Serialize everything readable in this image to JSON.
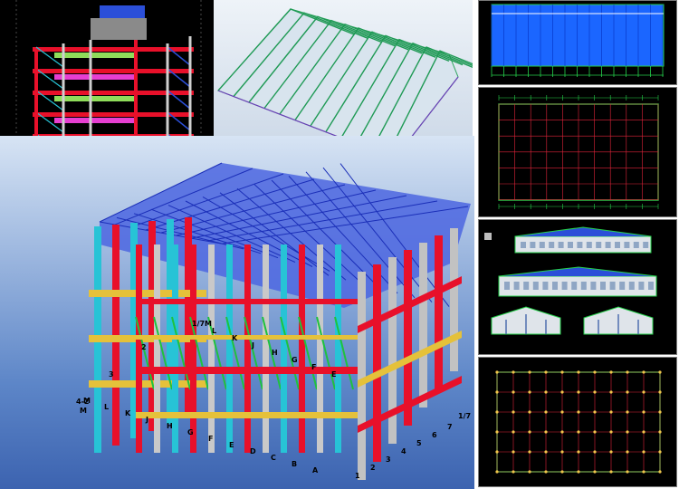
{
  "main_labels": {
    "top_right_axis": "1/7",
    "front_axis_letters": [
      "M",
      "L",
      "K",
      "J",
      "H",
      "G",
      "F",
      "E",
      "D",
      "C",
      "B",
      "A"
    ],
    "right_axis_numbers": [
      "1",
      "2",
      "3",
      "4",
      "5",
      "6",
      "7"
    ],
    "upper_axis_letters": [
      "1/7M",
      "L",
      "K",
      "J",
      "H",
      "G",
      "F",
      "E"
    ],
    "left_level_numbers": [
      "4-2",
      "3",
      "2"
    ],
    "left_axis_letter": "M"
  },
  "colors": {
    "steel_red": "#e8102a",
    "steel_blue": "#2b3fd8",
    "steel_cyan": "#27c3d6",
    "steel_yellow": "#e5c13a",
    "steel_green": "#1ec23e",
    "cad_background": "#000000",
    "cad_green": "#26d14b",
    "cad_red": "#e0243a"
  }
}
